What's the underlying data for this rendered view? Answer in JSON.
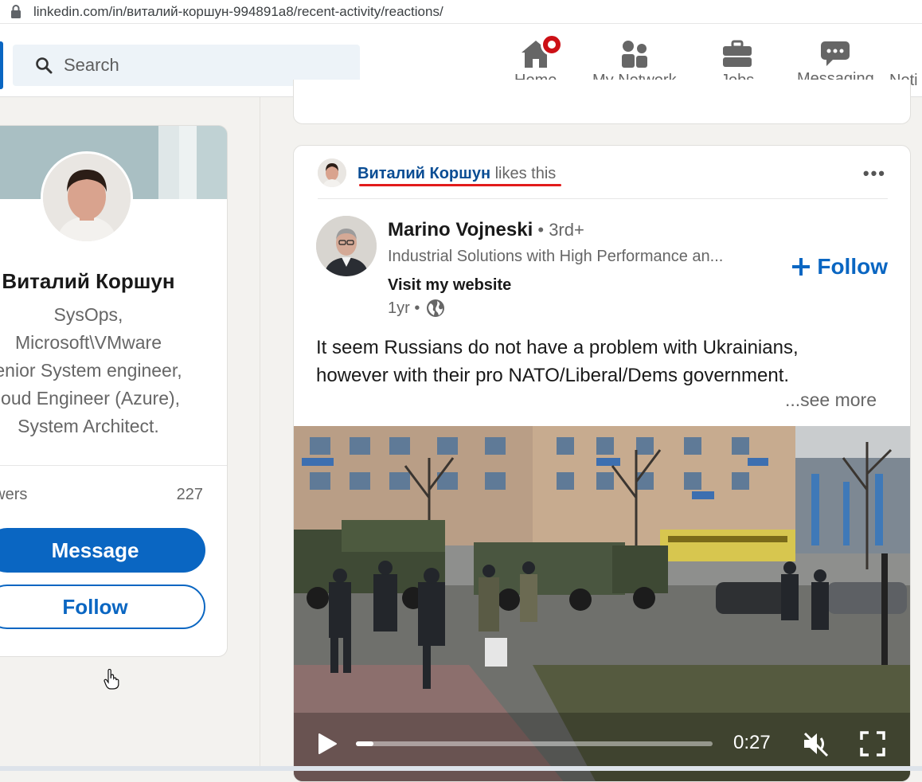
{
  "browser": {
    "url": "linkedin.com/in/виталий-коршун-994891a8/recent-activity/reactions/"
  },
  "nav": {
    "search_placeholder": "Search",
    "items": [
      {
        "label": "Home",
        "icon": "home-icon",
        "has_badge": true
      },
      {
        "label": "My Network",
        "icon": "network-icon"
      },
      {
        "label": "Jobs",
        "icon": "briefcase-icon"
      },
      {
        "label": "Messaging",
        "icon": "messaging-icon"
      },
      {
        "label": "Noti"
      }
    ]
  },
  "profile": {
    "name": "Виталий Коршун",
    "headline_lines": [
      "SysOps,",
      "Microsoft\\VMware",
      "enior System engineer,",
      "loud Engineer (Azure),",
      "System Architect."
    ],
    "followers_label": "owers",
    "followers_count": "227",
    "message_label": "Message",
    "follow_label": "Follow"
  },
  "post": {
    "context_name": "Виталий Коршун",
    "context_action": " likes this",
    "author_name": "Marino Vojneski",
    "author_degree": " • 3rd+",
    "author_tagline": "Industrial Solutions with High Performance an...",
    "author_link": "Visit my website",
    "time": "1yr •",
    "follow_label": "Follow",
    "text_lines": [
      "It seem Russians do not have a problem with Ukrainians,",
      "however with their pro NATO/Liberal/Dems government."
    ],
    "see_more": "...see more",
    "video": {
      "time": "0:27",
      "progress": 0.05
    }
  },
  "colors": {
    "brand": "#0a66c2",
    "highlight_underline": "#e21b1b",
    "badge": "#cc1016"
  }
}
